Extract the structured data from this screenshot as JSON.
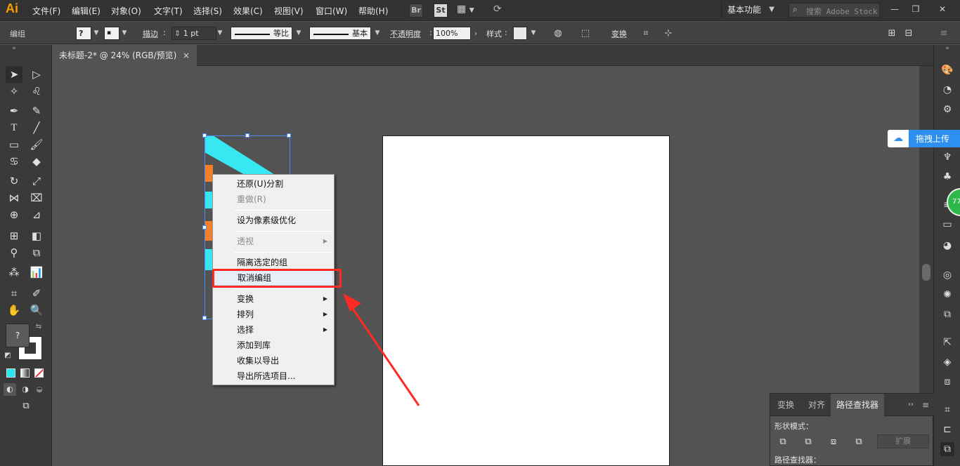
{
  "app": {
    "logo_text": "Ai"
  },
  "menubar": {
    "items": [
      "文件(F)",
      "编辑(E)",
      "对象(O)",
      "文字(T)",
      "选择(S)",
      "效果(C)",
      "视图(V)",
      "窗口(W)",
      "帮助(H)"
    ],
    "bridge_label": "Br",
    "stock_label": "St",
    "workspace": "基本功能",
    "search_placeholder": "搜索 Adobe Stock"
  },
  "control_bar": {
    "selection_label": "编组",
    "stroke_label": "描边",
    "stroke_weight": "1 pt",
    "profile_label": "等比",
    "brush_label": "基本",
    "opacity_label": "不透明度",
    "opacity_value": "100%",
    "style_label": "样式",
    "transform_label": "变换"
  },
  "document_tab": {
    "title": "未标题-2* @ 24% (RGB/预览)",
    "close_symbol": "×"
  },
  "context_menu": {
    "items": [
      {
        "label": "还原(U)分割",
        "disabled": false,
        "submenu": false
      },
      {
        "label": "重做(R)",
        "disabled": true,
        "submenu": false
      },
      {
        "label": "设为像素级优化",
        "disabled": false,
        "submenu": false
      },
      {
        "label": "透视",
        "disabled": true,
        "submenu": true
      },
      {
        "label": "隔离选定的组",
        "disabled": false,
        "submenu": false
      },
      {
        "label": "取消编组",
        "disabled": false,
        "submenu": false,
        "highlighted": true
      },
      {
        "label": "变换",
        "disabled": false,
        "submenu": true
      },
      {
        "label": "排列",
        "disabled": false,
        "submenu": true
      },
      {
        "label": "选择",
        "disabled": false,
        "submenu": true
      },
      {
        "label": "添加到库",
        "disabled": false,
        "submenu": false
      },
      {
        "label": "收集以导出",
        "disabled": false,
        "submenu": false
      },
      {
        "label": "导出所选项目...",
        "disabled": false,
        "submenu": false
      }
    ]
  },
  "upload_widget": {
    "label": "拖拽上传"
  },
  "badge": {
    "text": "77"
  },
  "pathfinder_panel": {
    "tabs": [
      "变换",
      "对齐",
      "路径查找器"
    ],
    "active_tab": "路径查找器",
    "shape_modes_label": "形状模式：",
    "pathfinders_label": "路径查找器：",
    "expand_label": "扩展"
  },
  "colors": {
    "annotation": "#ff2a22",
    "selection": "#4b8df8",
    "art_cyan": "#37e8f2",
    "art_orange": "#f47f2b",
    "fill_swatch": "#26e7f0",
    "none_swatch": "#e23a3a",
    "upload_blue": "#2d8ff0"
  }
}
